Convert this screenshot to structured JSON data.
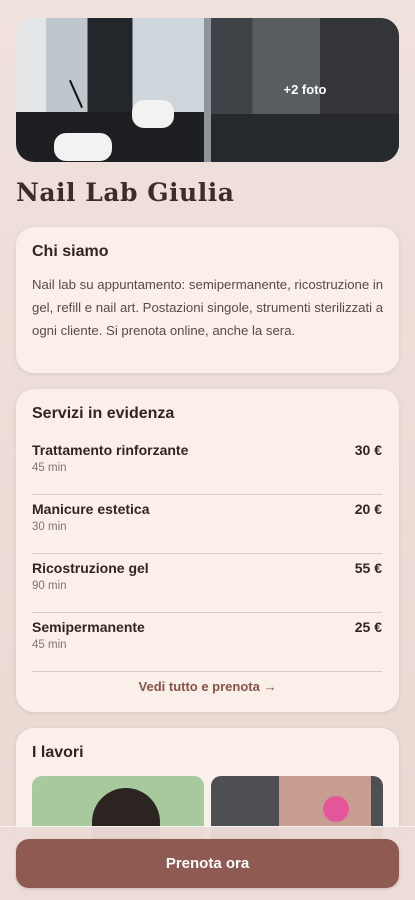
{
  "gallery": {
    "more_photos": "+2 foto"
  },
  "page_title": "Nail Lab Giulia",
  "about": {
    "heading": "Chi siamo",
    "text": "Nail lab su appuntamento: semipermanente, ricostruzione in gel, refill e nail art. Postazioni singole, strumenti sterilizzati a ogni cliente. Si prenota online, anche la sera."
  },
  "services": {
    "heading": "Servizi in evidenza",
    "items": [
      {
        "name": "Trattamento rinforzante",
        "duration": "45 min",
        "price": "30 €"
      },
      {
        "name": "Manicure estetica",
        "duration": "30 min",
        "price": "20 €"
      },
      {
        "name": "Ricostruzione gel",
        "duration": "90 min",
        "price": "55 €"
      },
      {
        "name": "Semipermanente",
        "duration": "45 min",
        "price": "25 €"
      }
    ],
    "see_all": "Vedi tutto e prenota →"
  },
  "works": {
    "heading": "I lavori"
  },
  "cta": {
    "label": "Prenota ora"
  }
}
